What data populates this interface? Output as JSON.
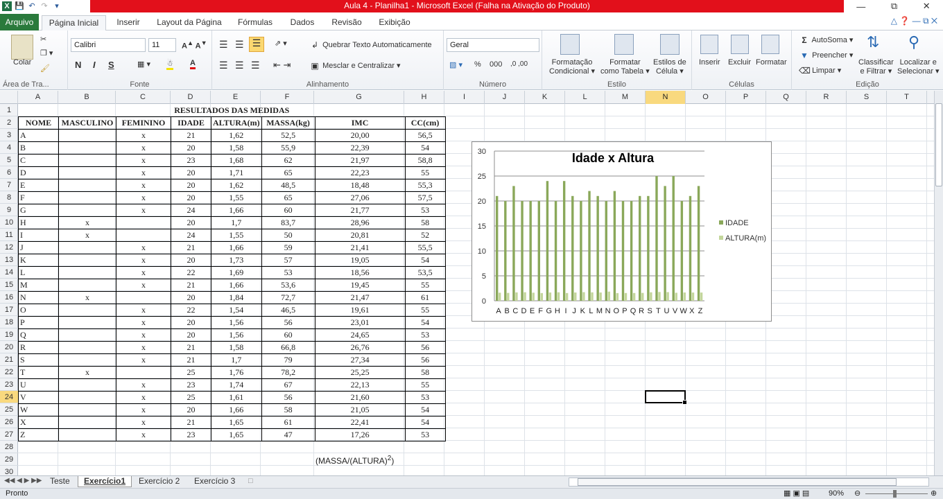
{
  "window": {
    "title": "Aula 4 - Planilha1 - Microsoft Excel (Falha na Ativação do Produto)"
  },
  "tabs": [
    {
      "label": "Arquivo"
    },
    {
      "label": "Página Inicial"
    },
    {
      "label": "Inserir"
    },
    {
      "label": "Layout da Página"
    },
    {
      "label": "Fórmulas"
    },
    {
      "label": "Dados"
    },
    {
      "label": "Revisão"
    },
    {
      "label": "Exibição"
    }
  ],
  "ribbon": {
    "clipboard": {
      "label": "Área de Tra...",
      "paste": "Colar"
    },
    "font": {
      "label": "Fonte",
      "name": "Calibri",
      "size": "11",
      "bold": "N",
      "italic": "I",
      "underline": "S"
    },
    "alignment": {
      "label": "Alinhamento",
      "wrap": "Quebrar Texto Automaticamente",
      "merge": "Mesclar e Centralizar"
    },
    "number": {
      "label": "Número",
      "format": "Geral",
      "percent": "%",
      "thousands": "000"
    },
    "styles": {
      "label": "Estilo",
      "cond1": "Formatação",
      "cond2": "Condicional",
      "table1": "Formatar",
      "table2": "como Tabela",
      "cell1": "Estilos de",
      "cell2": "Célula"
    },
    "cells": {
      "label": "Células",
      "insert": "Inserir",
      "delete": "Excluir",
      "format": "Formatar"
    },
    "editing": {
      "label": "Edição",
      "autosum": "AutoSoma",
      "fill": "Preencher",
      "clear": "Limpar",
      "sort1": "Classificar",
      "sort2": "e Filtrar",
      "find1": "Localizar e",
      "find2": "Selecionar"
    }
  },
  "columns": [
    "A",
    "B",
    "C",
    "D",
    "E",
    "F",
    "G",
    "H",
    "I",
    "J",
    "K",
    "L",
    "M",
    "N",
    "O",
    "P",
    "Q",
    "R",
    "S",
    "T"
  ],
  "selected_column": "N",
  "rows": [
    "1",
    "2",
    "3",
    "4",
    "5",
    "6",
    "7",
    "8",
    "9",
    "10",
    "11",
    "12",
    "13",
    "14",
    "15",
    "16",
    "17",
    "18",
    "19",
    "20",
    "21",
    "22",
    "23",
    "24",
    "25",
    "26",
    "27",
    "28",
    "29",
    "30"
  ],
  "selected_row": "24",
  "sheet": {
    "title": "RESULTADOS DAS MEDIDAS",
    "headers": [
      "NOME",
      "MASCULINO",
      "FEMININO",
      "IDADE",
      "ALTURA(m)",
      "MASSA(kg)",
      "IMC",
      "CC(cm)"
    ],
    "data": [
      [
        "A",
        "",
        "x",
        "21",
        "1,62",
        "52,5",
        "20,00",
        "56,5"
      ],
      [
        "B",
        "",
        "x",
        "20",
        "1,58",
        "55,9",
        "22,39",
        "54"
      ],
      [
        "C",
        "",
        "x",
        "23",
        "1,68",
        "62",
        "21,97",
        "58,8"
      ],
      [
        "D",
        "",
        "x",
        "20",
        "1,71",
        "65",
        "22,23",
        "55"
      ],
      [
        "E",
        "",
        "x",
        "20",
        "1,62",
        "48,5",
        "18,48",
        "55,3"
      ],
      [
        "F",
        "",
        "x",
        "20",
        "1,55",
        "65",
        "27,06",
        "57,5"
      ],
      [
        "G",
        "",
        "x",
        "24",
        "1,66",
        "60",
        "21,77",
        "53"
      ],
      [
        "H",
        "x",
        "",
        "20",
        "1,7",
        "83,7",
        "28,96",
        "58"
      ],
      [
        "I",
        "x",
        "",
        "24",
        "1,55",
        "50",
        "20,81",
        "52"
      ],
      [
        "J",
        "",
        "x",
        "21",
        "1,66",
        "59",
        "21,41",
        "55,5"
      ],
      [
        "K",
        "",
        "x",
        "20",
        "1,73",
        "57",
        "19,05",
        "54"
      ],
      [
        "L",
        "",
        "x",
        "22",
        "1,69",
        "53",
        "18,56",
        "53,5"
      ],
      [
        "M",
        "",
        "x",
        "21",
        "1,66",
        "53,6",
        "19,45",
        "55"
      ],
      [
        "N",
        "x",
        "",
        "20",
        "1,84",
        "72,7",
        "21,47",
        "61"
      ],
      [
        "O",
        "",
        "x",
        "22",
        "1,54",
        "46,5",
        "19,61",
        "55"
      ],
      [
        "P",
        "",
        "x",
        "20",
        "1,56",
        "56",
        "23,01",
        "54"
      ],
      [
        "Q",
        "",
        "x",
        "20",
        "1,56",
        "60",
        "24,65",
        "53"
      ],
      [
        "R",
        "",
        "x",
        "21",
        "1,58",
        "66,8",
        "26,76",
        "56"
      ],
      [
        "S",
        "",
        "x",
        "21",
        "1,7",
        "79",
        "27,34",
        "56"
      ],
      [
        "T",
        "x",
        "",
        "25",
        "1,76",
        "78,2",
        "25,25",
        "58"
      ],
      [
        "U",
        "",
        "x",
        "23",
        "1,74",
        "67",
        "22,13",
        "55"
      ],
      [
        "V",
        "",
        "x",
        "25",
        "1,61",
        "56",
        "21,60",
        "53"
      ],
      [
        "W",
        "",
        "x",
        "20",
        "1,66",
        "58",
        "21,05",
        "54"
      ],
      [
        "X",
        "",
        "x",
        "21",
        "1,65",
        "61",
        "22,41",
        "54"
      ],
      [
        "Z",
        "",
        "x",
        "23",
        "1,65",
        "47",
        "17,26",
        "53"
      ]
    ],
    "formula_note": "(MASSA/(ALTURA)",
    "formula_sup": "2",
    "formula_close": ")"
  },
  "chart_data": {
    "type": "bar",
    "title": "Idade x Altura",
    "categories": [
      "A",
      "B",
      "C",
      "D",
      "E",
      "F",
      "G",
      "H",
      "I",
      "J",
      "K",
      "L",
      "M",
      "N",
      "O",
      "P",
      "Q",
      "R",
      "S",
      "T",
      "U",
      "V",
      "W",
      "X",
      "Z"
    ],
    "series": [
      {
        "name": "IDADE",
        "color": "#8aa85a",
        "values": [
          21,
          20,
          23,
          20,
          20,
          20,
          24,
          20,
          24,
          21,
          20,
          22,
          21,
          20,
          22,
          20,
          20,
          21,
          21,
          25,
          23,
          25,
          20,
          21,
          23
        ]
      },
      {
        "name": "ALTURA(m)",
        "color": "#c3d69b",
        "values": [
          1.62,
          1.58,
          1.68,
          1.71,
          1.62,
          1.55,
          1.66,
          1.7,
          1.55,
          1.66,
          1.73,
          1.69,
          1.66,
          1.84,
          1.54,
          1.56,
          1.56,
          1.58,
          1.7,
          1.76,
          1.74,
          1.61,
          1.66,
          1.65,
          1.65
        ]
      }
    ],
    "yticks": [
      "0",
      "5",
      "10",
      "15",
      "20",
      "25",
      "30"
    ],
    "ylim": [
      0,
      30
    ],
    "grid": true,
    "legend_position": "right"
  },
  "sheet_tabs": [
    {
      "label": "Teste",
      "active": false
    },
    {
      "label": "Exercício1",
      "active": true
    },
    {
      "label": "Exercício 2",
      "active": false
    },
    {
      "label": "Exercício 3",
      "active": false
    }
  ],
  "status": {
    "ready": "Pronto",
    "zoom": "90%"
  }
}
